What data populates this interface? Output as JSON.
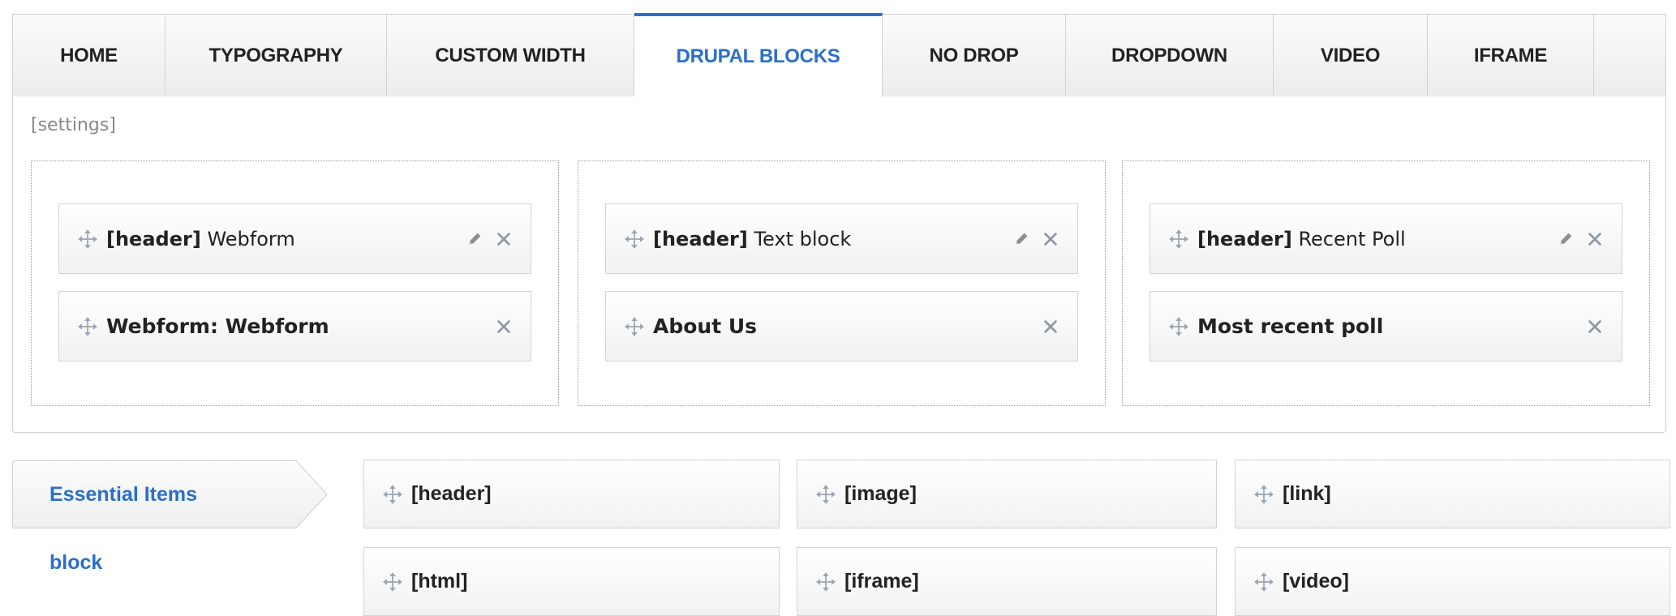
{
  "tabs": [
    {
      "label": "HOME",
      "active": false
    },
    {
      "label": "TYPOGRAPHY",
      "active": false
    },
    {
      "label": "CUSTOM WIDTH",
      "active": false
    },
    {
      "label": "DRUPAL BLOCKS",
      "active": true
    },
    {
      "label": "NO DROP",
      "active": false
    },
    {
      "label": "DROPDOWN",
      "active": false
    },
    {
      "label": "VIDEO",
      "active": false
    },
    {
      "label": "IFRAME",
      "active": false
    }
  ],
  "panel": {
    "settings_label": "[settings]",
    "columns": [
      {
        "header_tag": "[header]",
        "header_title": "Webform",
        "block_title": "Webform: Webform"
      },
      {
        "header_tag": "[header]",
        "header_title": "Text block",
        "block_title": "About Us"
      },
      {
        "header_tag": "[header]",
        "header_title": "Recent Poll",
        "block_title": "Most recent poll"
      }
    ]
  },
  "palette": {
    "categories": [
      {
        "label": "Essential Items",
        "active": true
      },
      {
        "label": "block",
        "active": false
      }
    ],
    "items": [
      "[header]",
      "[image]",
      "[link]",
      "[html]",
      "[iframe]",
      "[video]"
    ]
  },
  "icons": {
    "move": "move-arrows-icon",
    "edit": "pencil-icon",
    "remove": "close-icon"
  },
  "colors": {
    "accent": "#2a6fc9",
    "muted_text": "#888888",
    "border": "#cfcfcf"
  }
}
